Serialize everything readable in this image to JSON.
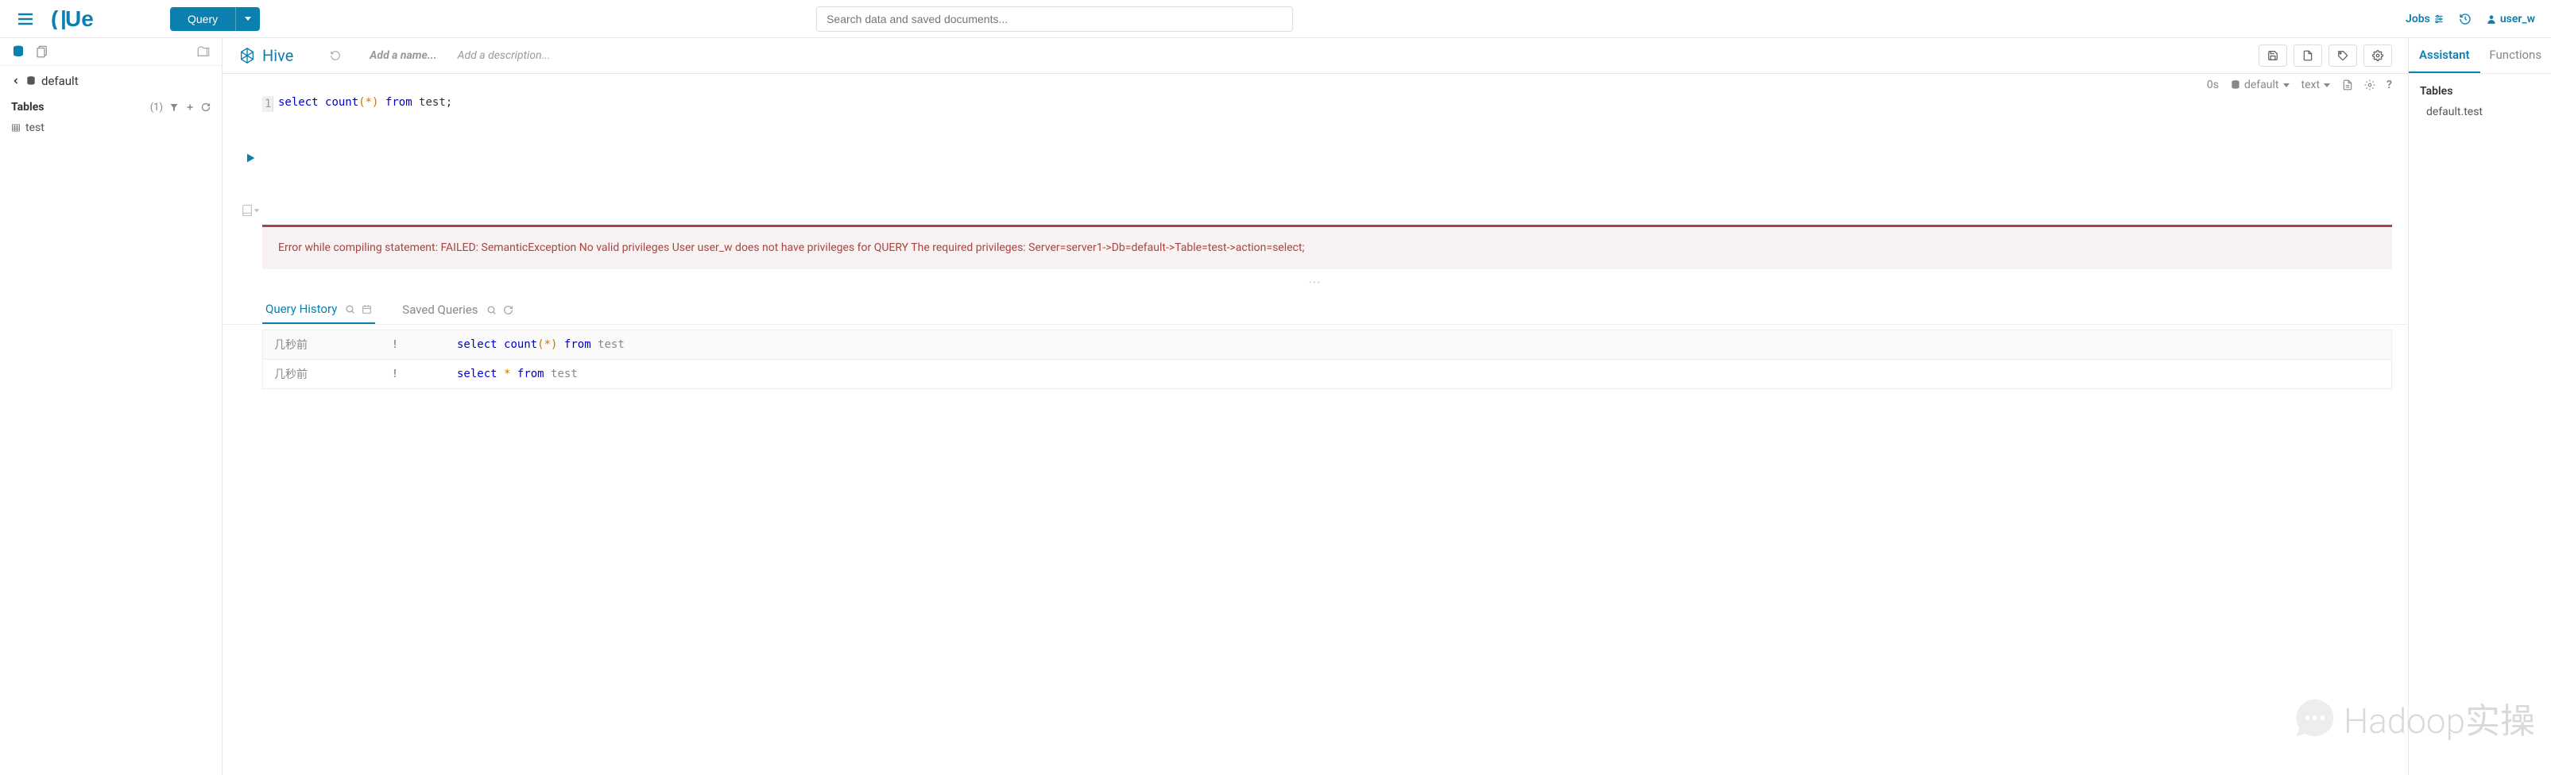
{
  "topbar": {
    "query_button": "Query",
    "search_placeholder": "Search data and saved documents...",
    "jobs_label": "Jobs",
    "user_label": "user_w"
  },
  "sidebar_left": {
    "breadcrumb": "default",
    "tables_label": "Tables",
    "tables_count": "(1)",
    "items": [
      "test"
    ]
  },
  "editor": {
    "engine": "Hive",
    "name_placeholder": "Add a name...",
    "desc_placeholder": "Add a description...",
    "toolbar": {
      "duration": "0s",
      "database": "default",
      "format": "text"
    },
    "line_num": "1",
    "error_message": "Error while compiling statement: FAILED: SemanticException No valid privileges User user_w does not have privileges for QUERY The required privileges: Server=server1->Db=default->Table=test->action=select;"
  },
  "tabs": {
    "history_label": "Query History",
    "saved_label": "Saved Queries"
  },
  "history": [
    {
      "time": "几秒前",
      "status": "!",
      "sql_kw1": "select",
      "sql_fn": "count",
      "sql_star": "(*)",
      "sql_kw2": "from",
      "sql_tbl": "test"
    },
    {
      "time": "几秒前",
      "status": "!",
      "sql_kw1": "select",
      "sql_fn": "",
      "sql_star": "*",
      "sql_kw2": "from",
      "sql_tbl": "test"
    }
  ],
  "right": {
    "assistant_tab": "Assistant",
    "functions_tab": "Functions",
    "tables_label": "Tables",
    "table_entry": "default.test"
  },
  "watermark": "Hadoop实操"
}
